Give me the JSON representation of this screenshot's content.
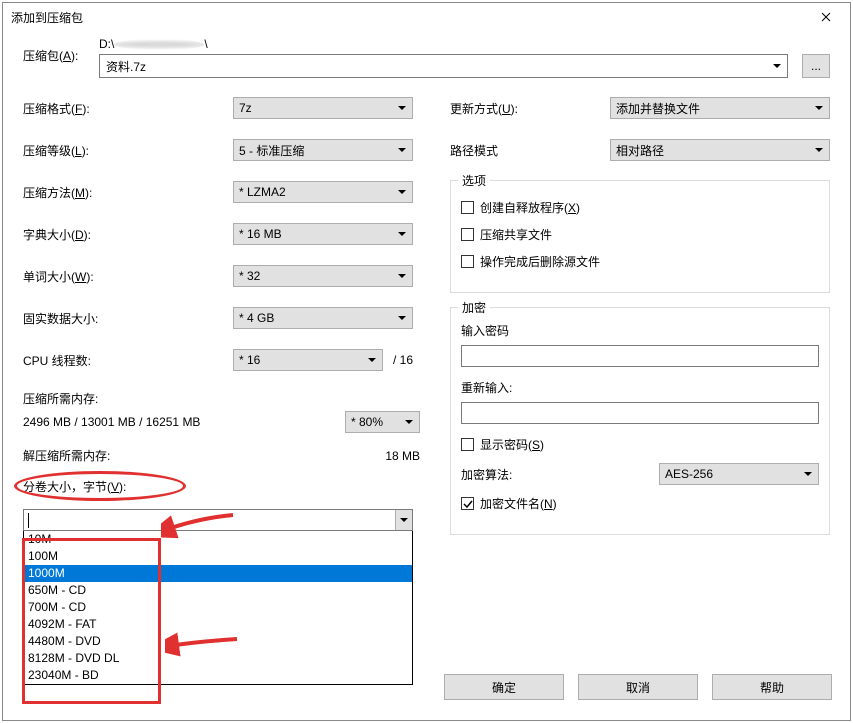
{
  "title": "添加到压缩包",
  "archive": {
    "label_pre": "压缩包(",
    "label_u": "A",
    "label_post": "):",
    "path_prefix": "D:\\",
    "path_suffix": "\\",
    "name": "资料.7z",
    "browse": "..."
  },
  "left": {
    "format": {
      "label_pre": "压缩格式(",
      "label_u": "F",
      "label_post": "):",
      "value": "7z"
    },
    "level": {
      "label_pre": "压缩等级(",
      "label_u": "L",
      "label_post": "):",
      "value": "5 - 标准压缩"
    },
    "method": {
      "label_pre": "压缩方法(",
      "label_u": "M",
      "label_post": "):",
      "value": "* LZMA2"
    },
    "dict": {
      "label_pre": "字典大小(",
      "label_u": "D",
      "label_post": "):",
      "value": "* 16 MB"
    },
    "word": {
      "label_pre": "单词大小(",
      "label_u": "W",
      "label_post": "):",
      "value": "* 32"
    },
    "solid": {
      "label": "固实数据大小:",
      "value": "* 4 GB"
    },
    "cpu": {
      "label": "CPU 线程数:",
      "value": "* 16",
      "max": "/ 16"
    },
    "mem_label": "压缩所需内存:",
    "mem_info": "2496 MB / 13001 MB / 16251 MB",
    "mem_percent": "* 80%",
    "decomp_label": "解压缩所需内存:",
    "decomp_value": "18 MB",
    "split_label_pre": "分卷大小，字节(",
    "split_label_u": "V",
    "split_label_post": "):",
    "split_options": [
      "10M",
      "100M",
      "1000M",
      "650M - CD",
      "700M - CD",
      "4092M - FAT",
      "4480M - DVD",
      "8128M - DVD DL",
      "23040M - BD"
    ],
    "split_selected": "1000M"
  },
  "right": {
    "update": {
      "label_pre": "更新方式(",
      "label_u": "U",
      "label_post": "):",
      "value": "添加并替换文件"
    },
    "path_mode": {
      "label": "路径模式",
      "value": "相对路径"
    },
    "options_legend": "选项",
    "opt_sfx_pre": "创建自释放程序(",
    "opt_sfx_u": "X",
    "opt_sfx_post": ")",
    "opt_share": "压缩共享文件",
    "opt_delete": "操作完成后删除源文件",
    "enc_legend": "加密",
    "pwd1_label": "输入密码",
    "pwd2_label": "重新输入:",
    "show_pwd_pre": "显示密码(",
    "show_pwd_u": "S",
    "show_pwd_post": ")",
    "enc_method_label": "加密算法:",
    "enc_method_value": "AES-256",
    "enc_names_pre": "加密文件名(",
    "enc_names_u": "N",
    "enc_names_post": ")"
  },
  "buttons": {
    "ok": "确定",
    "cancel": "取消",
    "help": "帮助"
  }
}
